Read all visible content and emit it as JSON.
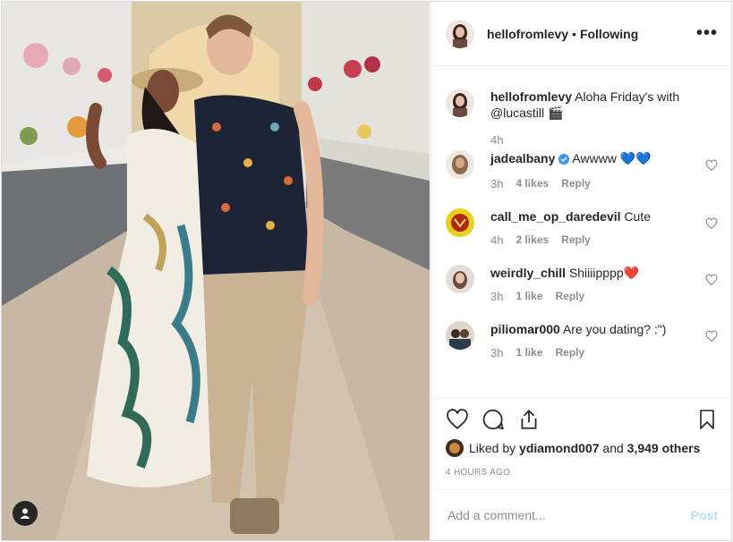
{
  "post": {
    "username": "hellofromlevy",
    "dot": "•",
    "follow_status": "Following",
    "more_icon": "more-horizontal-icon"
  },
  "caption": {
    "username": "hellofromlevy",
    "text": "Aloha Friday's with @lucastill 🎬",
    "time": "4h"
  },
  "comments": [
    {
      "username": "jadealbany",
      "verified": true,
      "text": "Awwww 💙💙",
      "time": "3h",
      "likes": "4 likes",
      "reply": "Reply"
    },
    {
      "username": "call_me_op_daredevil",
      "verified": false,
      "text": "Cute",
      "time": "4h",
      "likes": "2 likes",
      "reply": "Reply"
    },
    {
      "username": "weirdly_chill",
      "verified": false,
      "text": "Shiiiipppp❤️",
      "time": "3h",
      "likes": "1 like",
      "reply": "Reply"
    },
    {
      "username": "piliomar000",
      "verified": false,
      "text": "Are you dating? :\")",
      "time": "3h",
      "likes": "1 like",
      "reply": "Reply"
    }
  ],
  "likes": {
    "prefix": "Liked by",
    "user": "ydiamond007",
    "middle": "and",
    "count": "3,949 others"
  },
  "timestamp": "4 HOURS AGO",
  "add_comment": {
    "placeholder": "Add a comment...",
    "post_label": "Post"
  },
  "colors": {
    "accent_blue": "#0095f6",
    "post_disabled": "#b2dffc",
    "verified": "#3897f0"
  }
}
